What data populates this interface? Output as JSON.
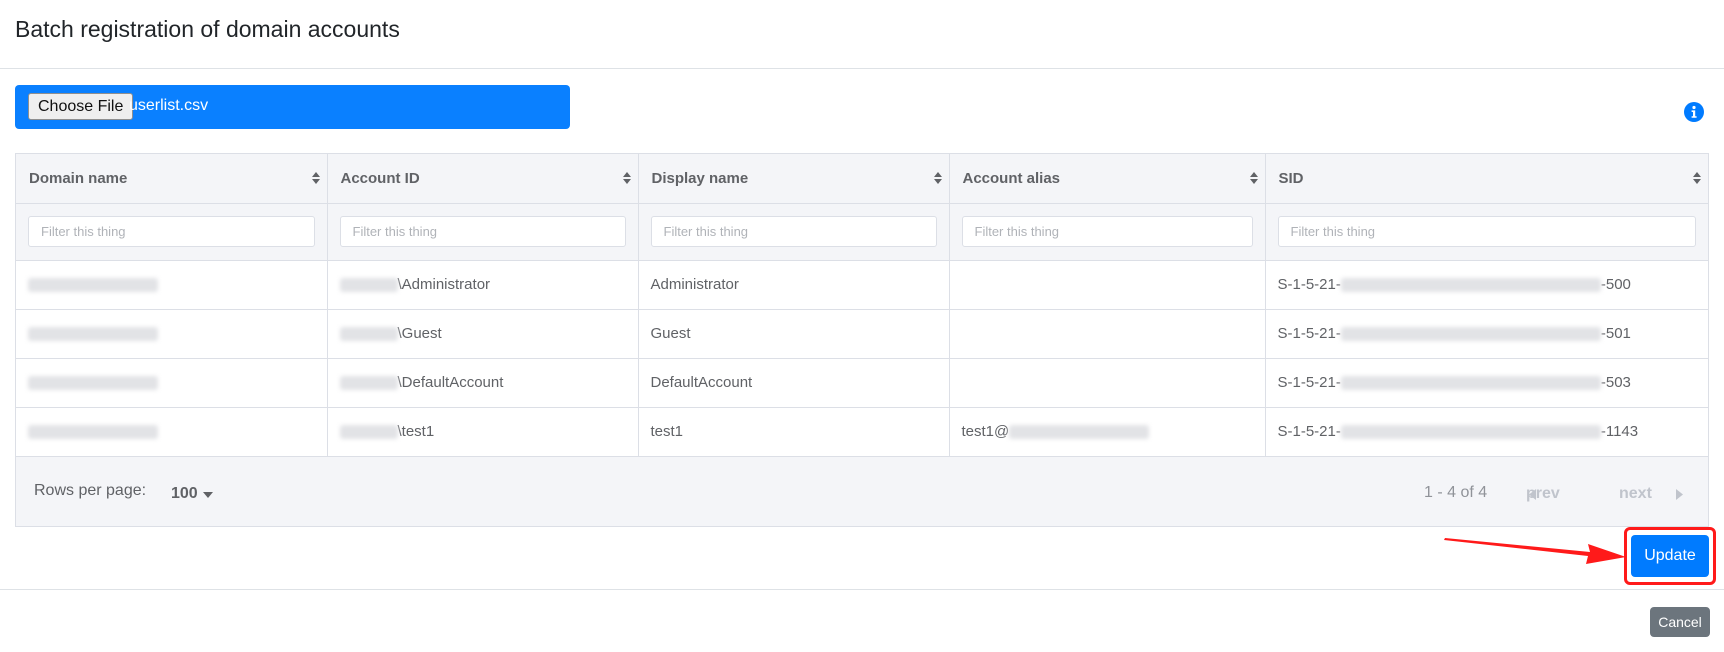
{
  "modal": {
    "title": "Batch registration of domain accounts"
  },
  "file_input": {
    "button_label": "Choose File",
    "file_name": "userlist.csv",
    "bar_color": "#0a80ff"
  },
  "info_icon": "info-circle-icon",
  "table": {
    "columns": [
      "Domain name",
      "Account ID",
      "Display name",
      "Account alias",
      "SID"
    ],
    "filter_placeholder": "Filter this thing",
    "rows": [
      {
        "domain_name": "",
        "account_id": "\\Administrator",
        "display_name": "Administrator",
        "account_alias": "",
        "sid_prefix": "S-1-5-21-",
        "sid_suffix": "-500"
      },
      {
        "domain_name": "",
        "account_id": "\\Guest",
        "display_name": "Guest",
        "account_alias": "",
        "sid_prefix": "S-1-5-21-",
        "sid_suffix": "-501"
      },
      {
        "domain_name": "",
        "account_id": "\\DefaultAccount",
        "display_name": "DefaultAccount",
        "account_alias": "",
        "sid_prefix": "S-1-5-21-",
        "sid_suffix": "-503"
      },
      {
        "domain_name": "",
        "account_id": "\\test1",
        "display_name": "test1",
        "account_alias": "test1@",
        "sid_prefix": "S-1-5-21-",
        "sid_suffix": "-1143"
      }
    ]
  },
  "pagination": {
    "rows_per_page_label": "Rows per page:",
    "rows_per_page_value": "100",
    "page_info": "1 - 4 of 4",
    "prev_label": "prev",
    "next_label": "next"
  },
  "actions": {
    "update_label": "Update",
    "cancel_label": "Cancel",
    "primary_color": "#007bff",
    "secondary_color": "#6c757d",
    "highlight_color": "#ff1a1a"
  }
}
